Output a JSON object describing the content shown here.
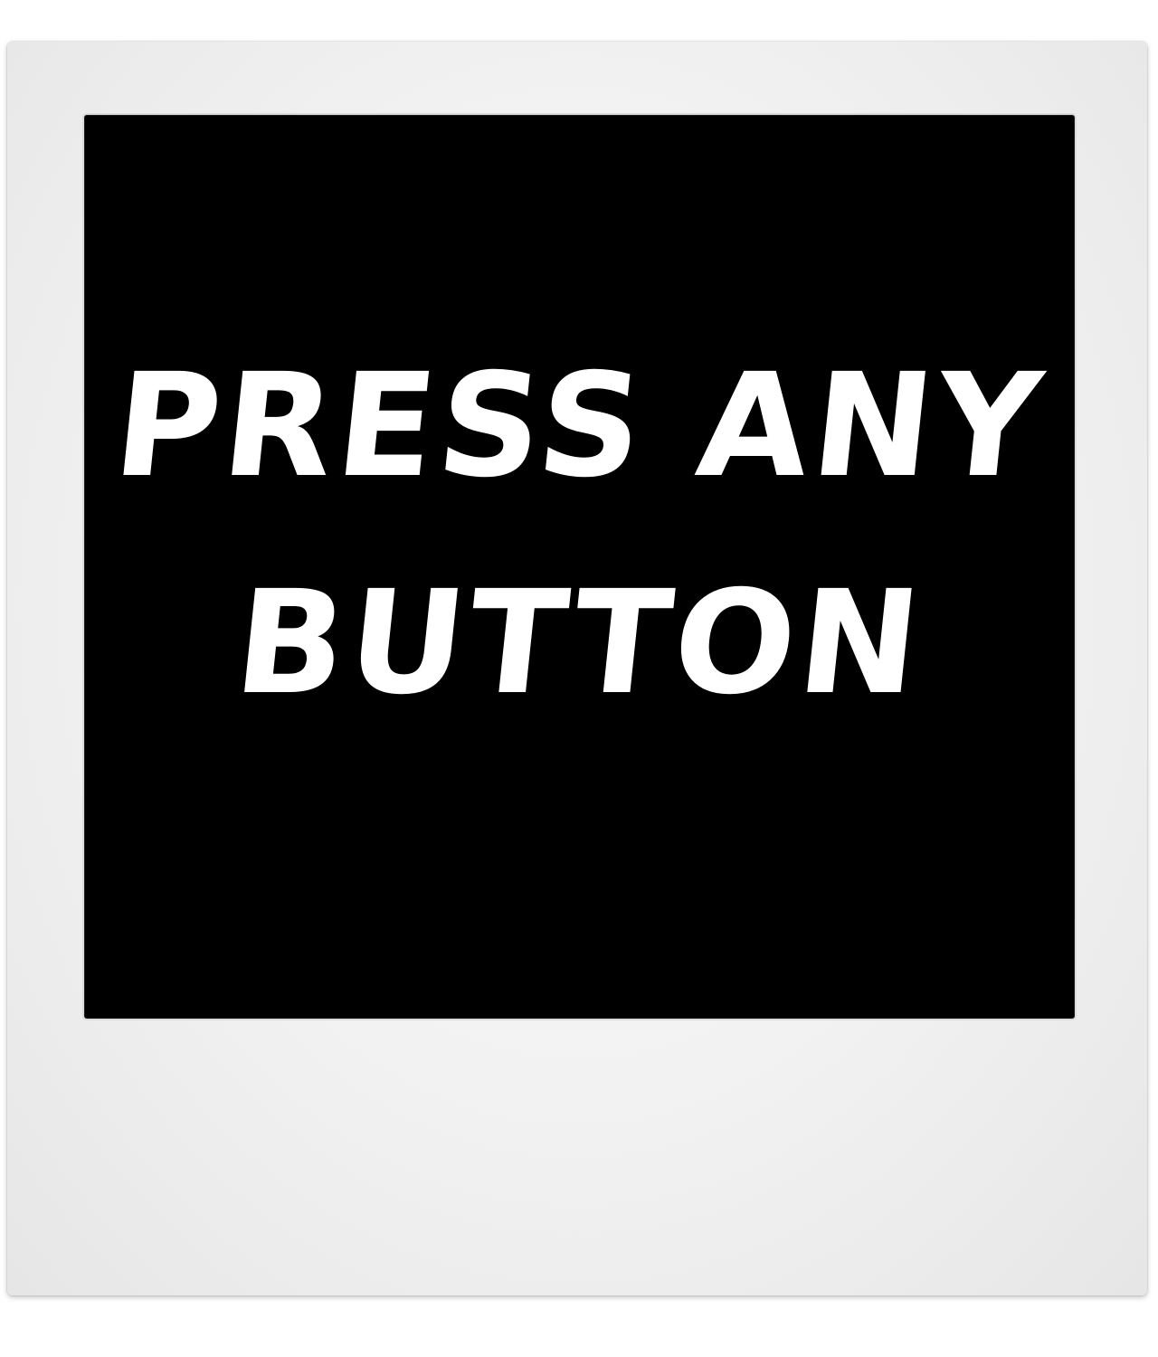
{
  "frame": {
    "frame_color": "#f1f1f1",
    "photo_color": "#000000",
    "text_color": "#ffffff"
  },
  "photo": {
    "line_1": "PRESS ANY",
    "line_2": "BUTTON"
  }
}
